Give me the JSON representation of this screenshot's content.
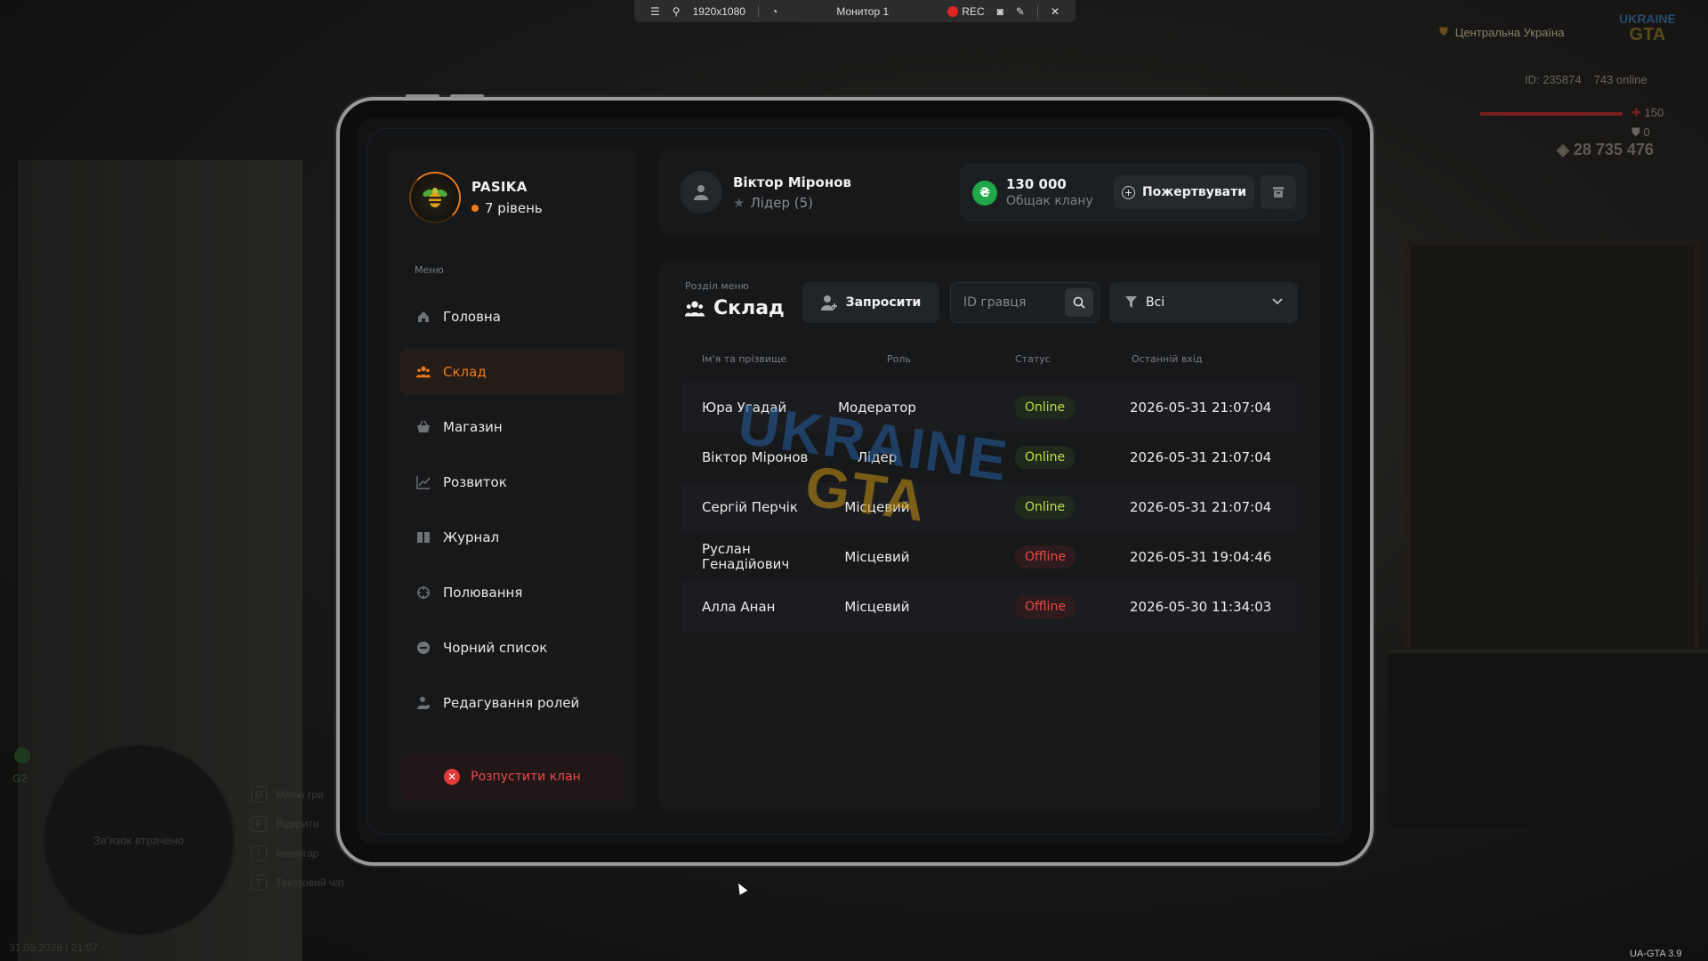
{
  "capture_bar": {
    "resolution": "1920x1080",
    "monitor": "Монитор 1",
    "rec": "REC"
  },
  "hud": {
    "region": "Центральна Україна",
    "logo_top": "UKRAINE",
    "logo_bottom": "GTA",
    "player_id": "ID: 235874",
    "online": "743 online",
    "health": "150",
    "armor": "0",
    "money": "28 735 476",
    "minimap_status": "Зв'язок втрачено",
    "g2": "G2",
    "hotkeys": [
      {
        "key": "O",
        "label": "Меню гри"
      },
      {
        "key": "P",
        "label": "Відкрити"
      },
      {
        "key": "I",
        "label": "Інвентар"
      },
      {
        "key": "T",
        "label": "Текстовий чат"
      }
    ],
    "date": "31.05.2026 | 21:07",
    "version": "UA-GTA 3.9"
  },
  "clan": {
    "name": "PASIKA",
    "level": "7 рівень"
  },
  "menu": {
    "caption": "Меню",
    "items": [
      {
        "label": "Головна",
        "icon": "home-icon",
        "active": false
      },
      {
        "label": "Склад",
        "icon": "members-icon",
        "active": true
      },
      {
        "label": "Магазин",
        "icon": "basket-icon",
        "active": false
      },
      {
        "label": "Розвиток",
        "icon": "chart-icon",
        "active": false
      },
      {
        "label": "Журнал",
        "icon": "book-icon",
        "active": false
      },
      {
        "label": "Полювання",
        "icon": "crosshair-icon",
        "active": false
      },
      {
        "label": "Чорний список",
        "icon": "block-icon",
        "active": false
      },
      {
        "label": "Редагування ролей",
        "icon": "user-edit-icon",
        "active": false
      }
    ],
    "disband_label": "Розпустити клан"
  },
  "user": {
    "name": "Віктор Міронов",
    "role": "Лідер (5)"
  },
  "bank": {
    "amount": "130 000",
    "label": "Общак клану",
    "donate_label": "Пожертвувати"
  },
  "section": {
    "caption": "Розділ меню",
    "title": "Склад",
    "invite_label": "Запросити",
    "search_placeholder": "ID гравця",
    "filter_value": "Всі"
  },
  "table": {
    "columns": [
      "Ім'я та прізвище",
      "Роль",
      "Статус",
      "Останній вхід"
    ],
    "rows": [
      {
        "name": "Юра Угадай",
        "role": "Модератор",
        "status": "Online",
        "last": "2026-05-31 21:07:04"
      },
      {
        "name": "Віктор Міронов",
        "role": "Лідер",
        "status": "Online",
        "last": "2026-05-31 21:07:04"
      },
      {
        "name": "Сергій Перчік",
        "role": "Місцевий",
        "status": "Online",
        "last": "2026-05-31 21:07:04"
      },
      {
        "name": "Руслан Генадійович",
        "role": "Місцевий",
        "status": "Offline",
        "last": "2026-05-31 19:04:46"
      },
      {
        "name": "Алла Анан",
        "role": "Місцевий",
        "status": "Offline",
        "last": "2026-05-30 11:34:03"
      }
    ]
  },
  "watermark": {
    "top": "UKRAINE",
    "bottom": "GTA"
  },
  "colors": {
    "accent": "#f07a1a",
    "online": "#b8e04a",
    "offline": "#e84848",
    "bank_coin": "#1fa74a"
  }
}
